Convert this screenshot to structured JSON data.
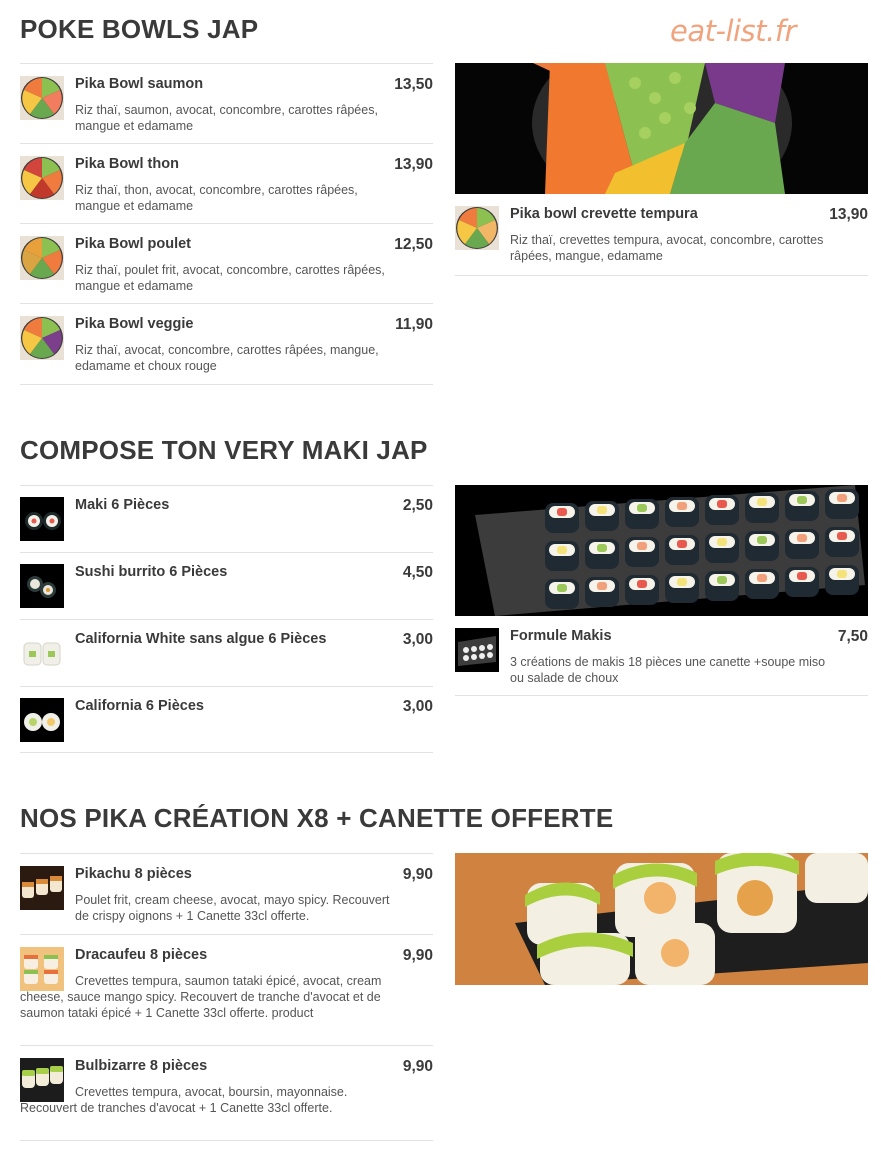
{
  "watermark": "eat-list.fr",
  "sections": [
    {
      "title": "POKE BOWLS JAP",
      "left_items": [
        {
          "name": "Pika Bowl saumon",
          "price": "13,50",
          "desc": "Riz thaï, saumon, avocat, concombre, carottes râpées, mangue et edamame",
          "icon": "poke-bowl-salmon-icon"
        },
        {
          "name": "Pika Bowl thon",
          "price": "13,90",
          "desc": "Riz thaï, thon, avocat, concombre, carottes râpées, mangue et edamame",
          "icon": "poke-bowl-tuna-icon"
        },
        {
          "name": "Pika Bowl poulet",
          "price": "12,50",
          "desc": "Riz thaï, poulet frit, avocat, concombre, carottes râpées, mangue et edamame",
          "icon": "poke-bowl-chicken-icon"
        },
        {
          "name": "Pika Bowl veggie",
          "price": "11,90",
          "desc": "Riz thaï, avocat, concombre, carottes râpées, mangue, edamame et choux rouge",
          "icon": "poke-bowl-veggie-icon"
        }
      ],
      "right_items": [
        {
          "name": "Pika bowl crevette tempura",
          "price": "13,90",
          "desc": "Riz thaï, crevettes tempura, avocat, concombre, carottes râpées, mangue, edamame",
          "icon": "poke-bowl-shrimp-icon"
        }
      ]
    },
    {
      "title": "COMPOSE TON VERY MAKI JAP",
      "left_items": [
        {
          "name": "Maki 6 Pièces",
          "price": "2,50",
          "icon": "maki-icon"
        },
        {
          "name": "Sushi burrito 6 Pièces",
          "price": "4,50",
          "icon": "sushi-burrito-icon"
        },
        {
          "name": "California White sans algue 6 Pièces",
          "price": "3,00",
          "icon": "california-white-icon"
        },
        {
          "name": "California 6 Pièces",
          "price": "3,00",
          "icon": "california-roll-icon"
        }
      ],
      "right_items": [
        {
          "name": "Formule Makis",
          "price": "7,50",
          "desc": "3 créations de makis 18 pièces une canette +soupe miso ou salade de choux",
          "icon": "makis-platter-icon"
        }
      ]
    },
    {
      "title": "NOS PIKA CRÉATION X8 + CANETTE OFFERTE",
      "left_items": [
        {
          "name": "Pikachu 8 pièces",
          "price": "9,90",
          "desc": "Poulet frit, cream cheese, avocat, mayo spicy. Recouvert de crispy oignons + 1 Canette 33cl offerte.",
          "icon": "pikachu-roll-icon"
        },
        {
          "name": "Dracaufeu 8 pièces",
          "price": "9,90",
          "desc": "Crevettes tempura, saumon tataki épicé, avocat, cream cheese, sauce mango spicy. Recouvert de tranche d'avocat et de saumon tataki épicé + 1 Canette 33cl offerte. product",
          "icon": "dracaufeu-roll-icon"
        },
        {
          "name": "Bulbizarre 8 pièces",
          "price": "9,90",
          "desc": "Crevettes tempura, avocat, boursin, mayonnaise. Recouvert de tranches d'avocat + 1 Canette 33cl offerte.",
          "icon": "bulbizarre-roll-icon"
        }
      ]
    }
  ]
}
